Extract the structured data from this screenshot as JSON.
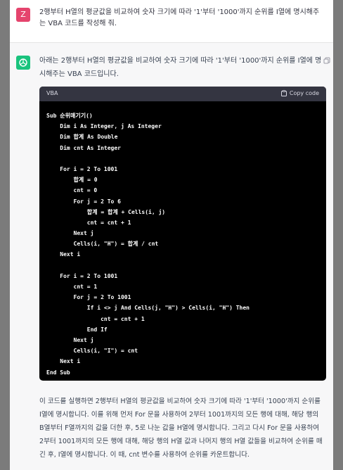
{
  "user_message": {
    "avatar_letter": "Z",
    "text": "2행부터 H열의 평균값을 비교하여 숫자 크기에 따라 '1'부터 '1000'까지 순위를 I열에 명시해주는 VBA 코드를 작성해 줘."
  },
  "assistant_message": {
    "intro": "아래는 2행부터 H열의 평균값을 비교하여 숫자 크기에 따라 '1'부터 '1000'까지 순위를 I열에 명시해주는 VBA 코드입니다.",
    "code_language": "VBA",
    "copy_code_label": "Copy code",
    "code_lines": [
      "Sub 순위매기기()",
      "    Dim i As Integer, j As Integer",
      "    Dim 합계 As Double",
      "    Dim cnt As Integer",
      "",
      "    For i = 2 To 1001",
      "        합계 = 0",
      "        cnt = 0",
      "        For j = 2 To 6",
      "            합계 = 합계 + Cells(i, j)",
      "            cnt = cnt + 1",
      "        Next j",
      "        Cells(i, \"H\") = 합계 / cnt",
      "    Next i",
      "",
      "    For i = 2 To 1001",
      "        cnt = 1",
      "        For j = 2 To 1001",
      "            If i <> j And Cells(j, \"H\") > Cells(i, \"H\") Then",
      "                cnt = cnt + 1",
      "            End If",
      "        Next j",
      "        Cells(i, \"I\") = cnt",
      "    Next i",
      "End Sub"
    ],
    "outro": "이 코드를 실행하면 2행부터 H열의 평균값을 비교하여 숫자 크기에 따라 '1'부터 '1000'까지 순위를 I열에 명시합니다. 이를 위해 먼저 For 문을 사용하여 2부터 1001까지의 모든 행에 대해, 해당 행의 B열부터 F열까지의 값을 더한 후, 5로 나눈 값을 H열에 명시합니다. 그리고 다시 For 문을 사용하여 2부터 1001까지의 모든 행에 대해, 해당 행의 H열 값과 나머지 행의 H열 값들을 비교하여 순위를 매긴 후, I열에 명시합니다. 이 때, cnt 변수를 사용하여 순위를 카운트합니다."
  },
  "colors": {
    "user_avatar": "#e5446d",
    "assistant_avatar": "#19c37d",
    "code_background": "#000000",
    "code_header": "#343541"
  }
}
